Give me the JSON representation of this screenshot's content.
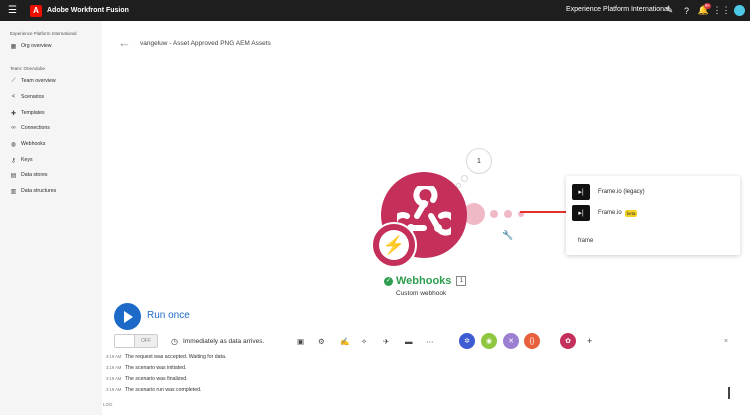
{
  "topbar": {
    "menu_icon": "hamburger-icon",
    "logo_letter": "A",
    "app_name": "Adobe Workfront Fusion",
    "org_name": "Experience Platform International",
    "notification_count": "9+"
  },
  "sidebar": {
    "org_label": "Experience Platform International",
    "org_overview": "Org overview",
    "team_label": "Team: OneAdobe",
    "items": [
      {
        "label": "Team overview",
        "icon": "chart-icon"
      },
      {
        "label": "Scenarios",
        "icon": "share-icon"
      },
      {
        "label": "Templates",
        "icon": "puzzle-icon"
      },
      {
        "label": "Connections",
        "icon": "link-icon"
      },
      {
        "label": "Webhooks",
        "icon": "globe-icon"
      },
      {
        "label": "Keys",
        "icon": "key-icon"
      },
      {
        "label": "Data stores",
        "icon": "database-icon"
      },
      {
        "label": "Data structures",
        "icon": "structure-icon"
      }
    ]
  },
  "scenario": {
    "back_icon": "←",
    "title": "vangeluw - Asset Approved PNG AEM Assets",
    "bubble_count": "1",
    "module_name": "Webhooks",
    "module_count": "1",
    "module_subtitle": "Custom webhook"
  },
  "popup": {
    "items": [
      {
        "label": "Frame.io (legacy)",
        "beta": ""
      },
      {
        "label": "Frame.io",
        "beta": "beta"
      }
    ],
    "search_value": "frame"
  },
  "toolbar": {
    "run_label": "Run once",
    "toggle_label": "OFF",
    "schedule_text": "Immediately as data arrives.",
    "plus": "+",
    "close": "×"
  },
  "log": {
    "label": "LOG",
    "entries": [
      {
        "time": "3:19 AM",
        "text": "The request was accepted. Waiting for data."
      },
      {
        "time": "3:19 AM",
        "text": "The scenario was initiated."
      },
      {
        "time": "3:19 AM",
        "text": "The scenario was finalized."
      },
      {
        "time": "3:19 AM",
        "text": "The scenario run was completed."
      }
    ]
  },
  "colors": {
    "accent": "#1c69c8",
    "webhook": "#c4305a",
    "success": "#2d9d4f",
    "arrow": "#e2312a"
  }
}
